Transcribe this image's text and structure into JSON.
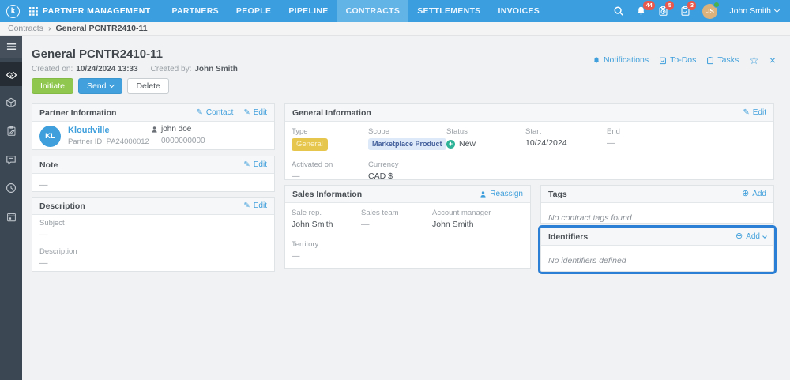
{
  "topbar": {
    "logo_letter": "k",
    "app_title": "PARTNER MANAGEMENT",
    "nav": [
      {
        "label": "PARTNERS"
      },
      {
        "label": "PEOPLE"
      },
      {
        "label": "PIPELINE"
      },
      {
        "label": "CONTRACTS",
        "active": true
      },
      {
        "label": "SETTLEMENTS"
      },
      {
        "label": "INVOICES"
      }
    ],
    "notifications_badge": "44",
    "todos_badge": "5",
    "tasks_badge": "3",
    "user": {
      "initials": "JS",
      "name": "John Smith"
    }
  },
  "breadcrumb": {
    "section": "Contracts",
    "separator": "›",
    "current": "General PCNTR2410-11"
  },
  "sidebar": {
    "items": [
      "menu",
      "contracts-handshake",
      "products-box",
      "orders-clipboard",
      "messages-chat",
      "history-clock",
      "calendar"
    ]
  },
  "page": {
    "title": "General PCNTR2410-11",
    "created_on_label": "Created on:",
    "created_on_value": "10/24/2024 13:33",
    "created_by_label": "Created by:",
    "created_by_value": "John Smith",
    "buttons": {
      "initiate": "Initiate",
      "send": "Send",
      "delete": "Delete"
    },
    "quick_links": {
      "notifications": "Notifications",
      "todos": "To-Dos",
      "tasks": "Tasks",
      "star": "☆",
      "close": "×"
    }
  },
  "partner_information": {
    "title": "Partner Information",
    "contact_link": "Contact",
    "edit_link": "Edit",
    "avatar_initials": "KL",
    "partner_name": "Kloudville",
    "partner_id": "Partner ID: PA24000012",
    "contact_name": "john doe",
    "contact_phone": "0000000000"
  },
  "note": {
    "title": "Note",
    "edit_link": "Edit",
    "value": "—"
  },
  "description": {
    "title": "Description",
    "edit_link": "Edit",
    "subject_label": "Subject",
    "subject_value": "—",
    "description_label": "Description",
    "description_value": "—"
  },
  "general_information": {
    "title": "General Information",
    "edit_link": "Edit",
    "type_label": "Type",
    "type_value": "General",
    "scope_label": "Scope",
    "scope_value": "Marketplace Product",
    "status_label": "Status",
    "status_value": "New",
    "start_label": "Start",
    "start_value": "10/24/2024",
    "end_label": "End",
    "end_value": "—",
    "activated_label": "Activated on",
    "activated_value": "—",
    "currency_label": "Currency",
    "currency_value": "CAD $"
  },
  "sales_information": {
    "title": "Sales Information",
    "reassign_link": "Reassign",
    "sale_rep_label": "Sale rep.",
    "sale_rep_value": "John Smith",
    "sales_team_label": "Sales team",
    "sales_team_value": "—",
    "account_manager_label": "Account manager",
    "account_manager_value": "John Smith",
    "territory_label": "Territory",
    "territory_value": "—"
  },
  "tags": {
    "title": "Tags",
    "add_link": "Add",
    "empty_text": "No contract tags found"
  },
  "identifiers": {
    "title": "Identifiers",
    "add_link": "Add",
    "empty_text": "No identifiers defined"
  },
  "colors": {
    "topbar_blue": "#3b9edf",
    "active_tab_blue": "#62b3e6",
    "sidebar_dark": "#3b4753",
    "accent_link_blue": "#3f9fdc",
    "initiate_green": "#8fc74f",
    "badge_red": "#e8584d",
    "highlight_border_blue": "#2b7fd4",
    "type_badge_yellow": "#e7c64e",
    "scope_badge_bg": "#dde9f8",
    "scope_badge_text": "#44609c",
    "status_teal": "#2eb398",
    "avatar_tan": "#dcb27c"
  }
}
